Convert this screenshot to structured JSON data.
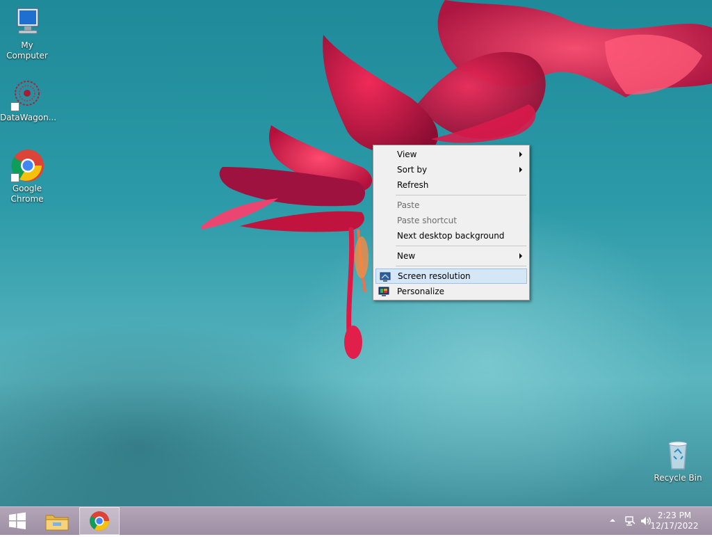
{
  "desktop": {
    "icons": [
      {
        "label": "My Computer"
      },
      {
        "label": "DataWagon..."
      },
      {
        "label_line1": "Google",
        "label_line2": "Chrome"
      },
      {
        "label": "Recycle Bin"
      }
    ]
  },
  "context_menu": {
    "items": [
      {
        "label": "View",
        "submenu": true
      },
      {
        "label": "Sort by",
        "submenu": true
      },
      {
        "label": "Refresh"
      },
      {
        "label": "Paste",
        "disabled": true
      },
      {
        "label": "Paste shortcut",
        "disabled": true
      },
      {
        "label": "Next desktop background"
      },
      {
        "label": "New",
        "submenu": true
      },
      {
        "label": "Screen resolution",
        "highlighted": true,
        "icon": "screen-resolution-icon"
      },
      {
        "label": "Personalize",
        "icon": "personalize-icon"
      }
    ]
  },
  "taskbar": {
    "start_icon": "windows-logo-icon",
    "pinned": [
      "file-explorer-icon",
      "chrome-icon"
    ],
    "tray_icons": [
      "show-hidden-icons-arrow",
      "network-icon",
      "volume-icon"
    ],
    "clock": {
      "time": "2:23 PM",
      "date": "12/17/2022"
    }
  },
  "colors": {
    "taskbar": "#a596aa",
    "menu_highlight": "#d5e6f7",
    "wallpaper_teal": "#2c9aa8",
    "flower": "#e0204a"
  }
}
